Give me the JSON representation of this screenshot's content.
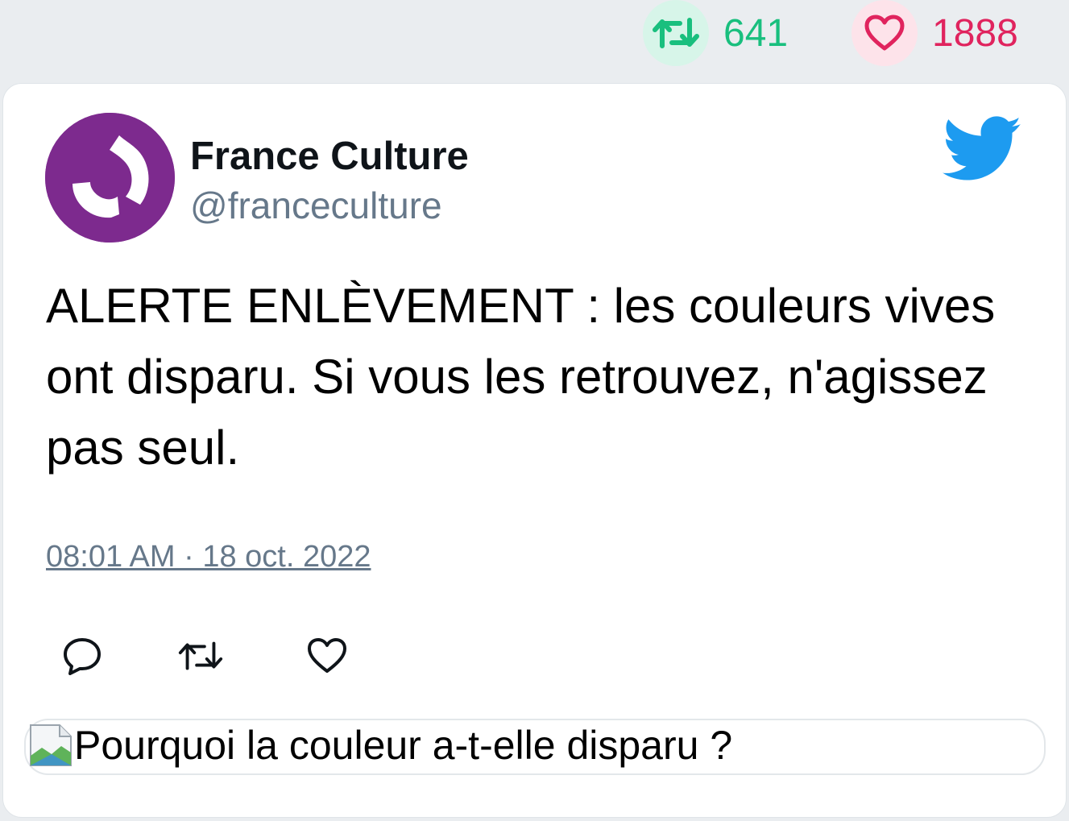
{
  "stats": {
    "retweet_count": "641",
    "like_count": "1888",
    "retweet_color": "#19bf7e",
    "like_color": "#e0245e"
  },
  "tweet": {
    "author_name": "France Culture",
    "author_handle": "@franceculture",
    "avatar_icon": "france-culture-logo",
    "brand_icon": "twitter-bird-icon",
    "brand_color": "#1d9bf0",
    "text": "ALERTE ENLÈVEMENT : les couleurs vives ont disparu. Si vous les retrouvez, n'agissez pas seul.",
    "timestamp": "08:01 AM · 18 oct. 2022"
  },
  "actions": {
    "reply_icon": "reply-icon",
    "retweet_icon": "retweet-icon",
    "like_icon": "heart-icon"
  },
  "link_card": {
    "image_icon": "broken-image-icon",
    "title": "Pourquoi la couleur a-t-elle disparu ?"
  }
}
